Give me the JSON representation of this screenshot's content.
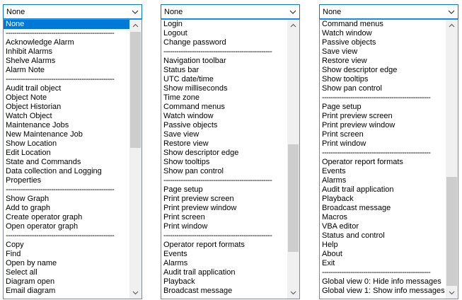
{
  "panels": [
    {
      "selected_value": "None",
      "items": [
        "None",
        "--------------------------------------------------",
        "Acknowledge Alarm",
        "Inhibit Alarms",
        "Shelve Alarms",
        "Alarm Note",
        "--------------------------------------------------",
        "Audit trail object",
        "Object Note",
        "Object Historian",
        "Watch Object",
        "Maintenance Jobs",
        "New Maintenance Job",
        "Show Location",
        "Edit Location",
        "State and Commands",
        "Data collection and Logging",
        "Properties",
        "--------------------------------------------------",
        "Show Graph",
        "Add to graph",
        "Create operator graph",
        "Open operator graph",
        "--------------------------------------------------",
        "Copy",
        "Find",
        "Open by name",
        "Select all",
        "Diagram open",
        "Email diagram"
      ],
      "highlighted_index": 0
    },
    {
      "selected_value": "None",
      "items": [
        "Login",
        "Logout",
        "Change password",
        "--------------------------------------------------",
        "Navigation toolbar",
        "Status bar",
        "UTC date/time",
        "Show milliseconds",
        "Time zone",
        "Command menus",
        "Watch window",
        "Passive objects",
        "Save view",
        "Restore view",
        "Show descriptor edge",
        "Show tooltips",
        "Show pan control",
        "--------------------------------------------------",
        "Page setup",
        "Print preview screen",
        "Print preview window",
        "Print screen",
        "Print window",
        "--------------------------------------------------",
        "Operator report formats",
        "Events",
        "Alarms",
        "Audit trail application",
        "Playback",
        "Broadcast message"
      ],
      "highlighted_index": -1
    },
    {
      "selected_value": "None",
      "items": [
        "Command menus",
        "Watch window",
        "Passive objects",
        "Save view",
        "Restore view",
        "Show descriptor edge",
        "Show tooltips",
        "Show pan control",
        "--------------------------------------------------",
        "Page setup",
        "Print preview screen",
        "Print preview window",
        "Print screen",
        "Print window",
        "--------------------------------------------------",
        "Operator report formats",
        "Events",
        "Alarms",
        "Audit trail application",
        "Playback",
        "Broadcast message",
        "Macros",
        "VBA editor",
        "Status and control",
        "Help",
        "About",
        "Exit",
        "--------------------------------------------------",
        "Global view  0: Hide info messages",
        "Global view  1: Show info messages"
      ],
      "highlighted_index": -1
    }
  ],
  "icons": {
    "dropdown": "chevron-down-icon",
    "scroll_up": "scroll-up-arrow-icon",
    "scroll_down": "scroll-down-arrow-icon"
  },
  "colors": {
    "accent": "#0078d7",
    "thumb": "#cdcdcd",
    "track": "#f0f0f0"
  }
}
